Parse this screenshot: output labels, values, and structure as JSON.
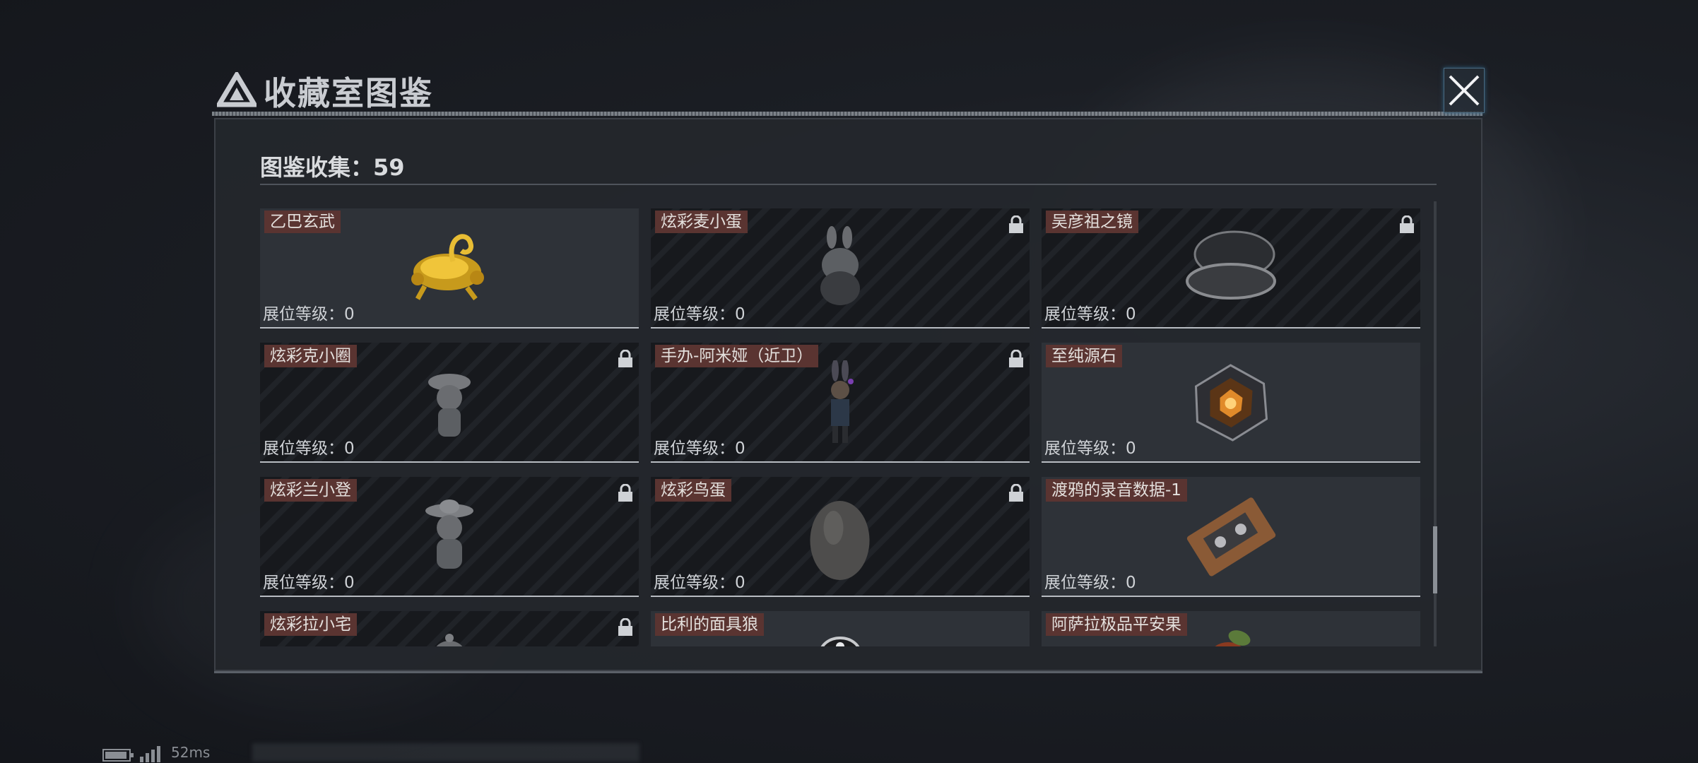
{
  "window": {
    "title": "收藏室图鉴"
  },
  "collection": {
    "label": "图鉴收集：59"
  },
  "items": [
    {
      "name": "乙巴玄武",
      "level": "展位等级：0",
      "locked": false,
      "icon": "golden-dragon-turtle-figure"
    },
    {
      "name": "炫彩麦小蛋",
      "level": "展位等级：0",
      "locked": true,
      "icon": "bunny-egg-figure"
    },
    {
      "name": "吴彦祖之镜",
      "level": "展位等级：0",
      "locked": true,
      "icon": "compact-mirror"
    },
    {
      "name": "炫彩克小圈",
      "level": "展位等级：0",
      "locked": true,
      "icon": "hat-figure"
    },
    {
      "name": "手办-阿米娅（近卫）",
      "level": "展位等级：0",
      "locked": true,
      "icon": "amiya-figure"
    },
    {
      "name": "至纯源石",
      "level": "展位等级：0",
      "locked": false,
      "icon": "originium-crystal"
    },
    {
      "name": "炫彩兰小登",
      "level": "展位等级：0",
      "locked": true,
      "icon": "sombrero-figure"
    },
    {
      "name": "炫彩鸟蛋",
      "level": "展位等级：0",
      "locked": true,
      "icon": "egg"
    },
    {
      "name": "渡鸦的录音数据-1",
      "level": "展位等级：0",
      "locked": false,
      "icon": "cassette-tape"
    },
    {
      "name": "炫彩拉小宅",
      "level": "",
      "locked": true,
      "icon": "figure-partial"
    },
    {
      "name": "比利的面具狼",
      "level": "",
      "locked": false,
      "icon": "wolf-mask-partial"
    },
    {
      "name": "阿萨拉极品平安果",
      "level": "",
      "locked": false,
      "icon": "apple-partial"
    }
  ],
  "status": {
    "latency": "52ms"
  },
  "colors": {
    "tag_bg": "#5a3431",
    "panel_bg": "#24272d",
    "accent_line": "#8e949b"
  }
}
